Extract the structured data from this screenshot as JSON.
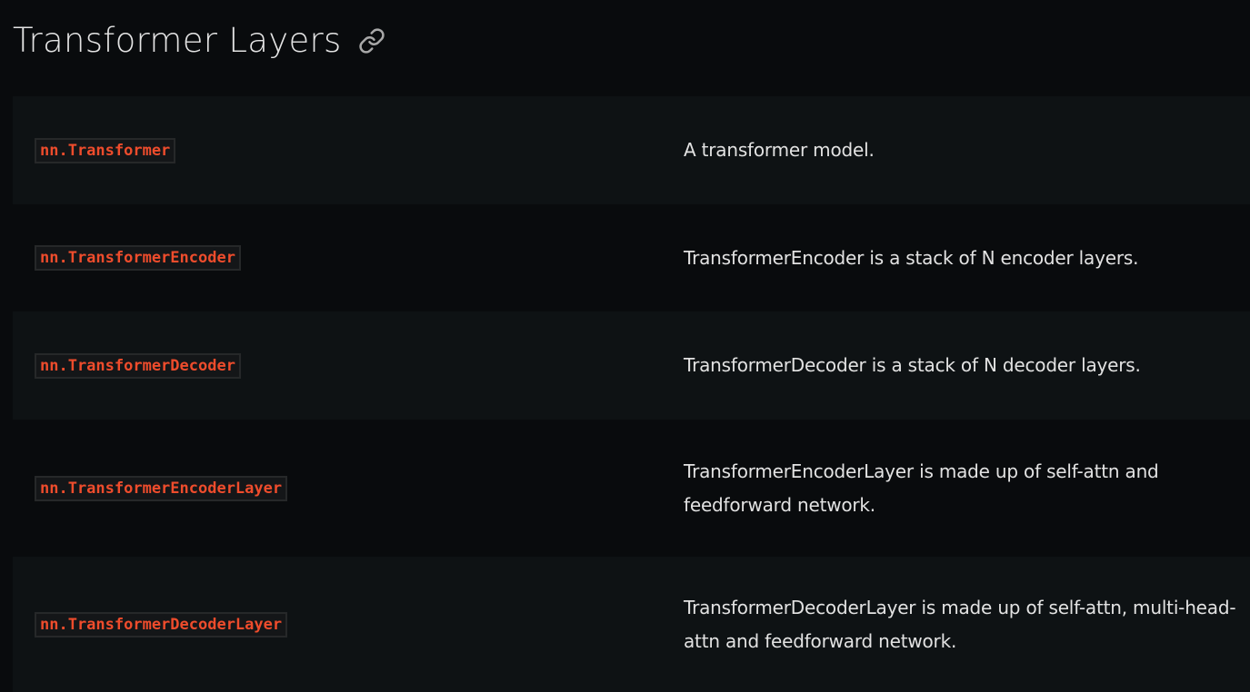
{
  "section": {
    "title": "Transformer Layers",
    "anchor_icon": "link-icon"
  },
  "colors": {
    "background": "#090b0d",
    "row_alt": "#0e1214",
    "code_text": "#ee4c2c",
    "code_bg": "#141618",
    "text": "#e2e2e2"
  },
  "rows": [
    {
      "name": "nn.Transformer",
      "description": "A transformer model."
    },
    {
      "name": "nn.TransformerEncoder",
      "description": "TransformerEncoder is a stack of N encoder layers."
    },
    {
      "name": "nn.TransformerDecoder",
      "description": "TransformerDecoder is a stack of N decoder layers."
    },
    {
      "name": "nn.TransformerEncoderLayer",
      "description": "TransformerEncoderLayer is made up of self-attn and feedforward network."
    },
    {
      "name": "nn.TransformerDecoderLayer",
      "description": "TransformerDecoderLayer is made up of self-attn, multi-head-attn and feedforward network."
    }
  ]
}
